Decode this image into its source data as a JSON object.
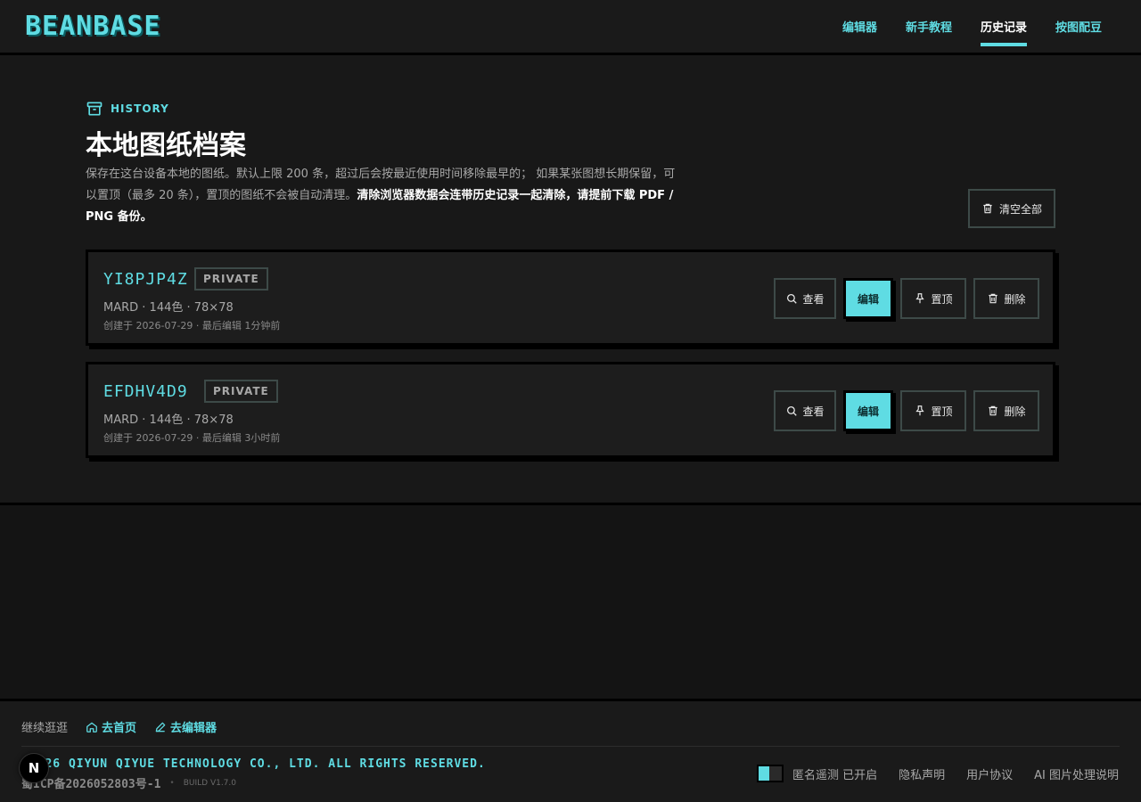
{
  "app": {
    "logo": "BEANBASE"
  },
  "nav": {
    "items": [
      {
        "label": "编辑器",
        "active": false
      },
      {
        "label": "新手教程",
        "active": false
      },
      {
        "label": "历史记录",
        "active": true
      },
      {
        "label": "按图配豆",
        "active": false
      }
    ]
  },
  "page": {
    "kicker": "HISTORY",
    "title": "本地图纸档案",
    "desc_normal": "保存在这台设备本地的图纸。默认上限 200 条，超过后会按最近使用时间移除最早的； 如果某张图想长期保留，可以置顶（最多 20 条），置顶的图纸不会被自动清理。",
    "desc_bold": "清除浏览器数据会连带历史记录一起清除，请提前下载 PDF / PNG 备份。",
    "clear_all_label": "清空全部"
  },
  "records": [
    {
      "id": "YI8PJP4Z",
      "badge": "PRIVATE",
      "meta": "MARD · 144色 · 78×78",
      "time": "创建于 2026-07-29 · 最后编辑 1分钟前",
      "actions": {
        "view": "查看",
        "edit": "编辑",
        "pin": "置顶",
        "delete": "删除"
      }
    },
    {
      "id": "EFDHV4D9",
      "badge": "PRIVATE",
      "meta": "MARD · 144色 · 78×78",
      "time": "创建于 2026-07-29 · 最后编辑 3小时前",
      "actions": {
        "view": "查看",
        "edit": "编辑",
        "pin": "置顶",
        "delete": "删除"
      }
    }
  ],
  "footer": {
    "continue_label": "继续逛逛",
    "home_link": "去首页",
    "editor_link": "去编辑器",
    "copyright": "©2026 QIYUN QIYUE TECHNOLOGY CO., LTD. ALL RIGHTS RESERVED.",
    "icp": "蜀ICP备2026052803号-1",
    "dot": "•",
    "build": "BUILD V1.7.0",
    "telemetry_label": "匿名遥测 已开启",
    "telemetry_on": true,
    "privacy": "隐私声明",
    "terms": "用户协议",
    "ai_notice": "AI 图片处理说明"
  },
  "next_badge": "N",
  "colors": {
    "accent": "#5fdce3",
    "background": "#141414",
    "card": "#1d1d1d",
    "border": "#3d4a48"
  }
}
